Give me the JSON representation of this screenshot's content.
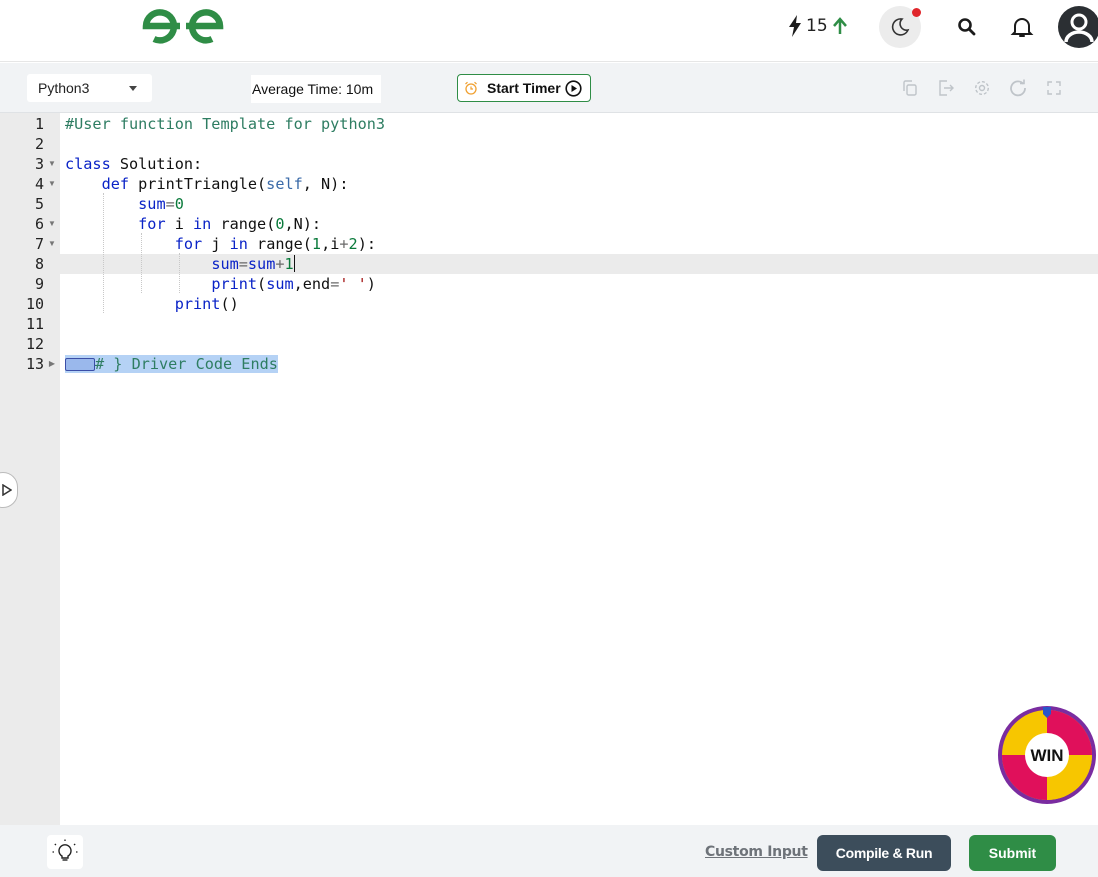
{
  "header": {
    "logo_text": "GfG",
    "streak_count": "15"
  },
  "toolbar": {
    "language": "Python3",
    "average_time": "Average Time: 10m",
    "start_timer": "Start Timer",
    "icons": [
      "copy-icon",
      "exit-icon",
      "settings-icon",
      "reset-icon",
      "fullscreen-icon"
    ]
  },
  "editor": {
    "active_line": 8,
    "lines": [
      {
        "n": "1",
        "text": "#User function Template for python3"
      },
      {
        "n": "2",
        "text": ""
      },
      {
        "n": "3",
        "text": "class Solution:"
      },
      {
        "n": "4",
        "text": "    def printTriangle(self, N):"
      },
      {
        "n": "5",
        "text": "        sum=0"
      },
      {
        "n": "6",
        "text": "        for i in range(0,N):"
      },
      {
        "n": "7",
        "text": "            for j in range(1,i+2):"
      },
      {
        "n": "8",
        "text": "                sum=sum+1"
      },
      {
        "n": "9",
        "text": "                print(sum,end=' ')"
      },
      {
        "n": "10",
        "text": "            print()"
      },
      {
        "n": "11",
        "text": ""
      },
      {
        "n": "12",
        "text": ""
      },
      {
        "n": "13",
        "text": "# } Driver Code Ends"
      }
    ]
  },
  "win_badge": "WIN",
  "footer": {
    "custom_input": "Custom Input",
    "compile_run": "Compile & Run",
    "submit": "Submit"
  },
  "colors": {
    "brand_green": "#2f8d46",
    "compile_bg": "#3c4d5b",
    "notification_dot": "#e0262b"
  }
}
